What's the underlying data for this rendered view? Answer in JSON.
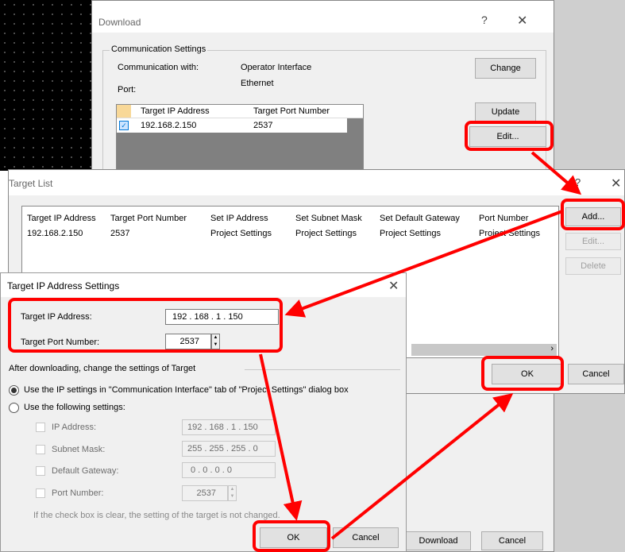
{
  "download": {
    "title": "Download",
    "help": "?",
    "close": "✕",
    "group_title": "Communication Settings",
    "comm_with_label": "Communication with:",
    "comm_with_value": "Operator Interface",
    "port_label": "Port:",
    "port_value": "Ethernet",
    "table_headers": [
      "Target IP Address",
      "Target Port Number"
    ],
    "table_rows": [
      {
        "ip": "192.168.2.150",
        "port": "2537",
        "checked": true
      }
    ],
    "change_label": "Change",
    "update_label": "Update",
    "edit_label": "Edit...",
    "download_label": "Download",
    "cancel_label": "Cancel"
  },
  "target_list": {
    "title": "Target List",
    "help": "?",
    "close": "✕",
    "headers": [
      "Target IP Address",
      "Target Port Number",
      "Set IP Address",
      "Set Subnet Mask",
      "Set Default Gateway",
      "Port Number"
    ],
    "rows": [
      [
        "192.168.2.150",
        "2537",
        "Project Settings",
        "Project Settings",
        "Project Settings",
        "Project Settings"
      ]
    ],
    "add_label": "Add...",
    "edit_label": "Edit...",
    "delete_label": "Delete",
    "ok_label": "OK",
    "cancel_label": "Cancel"
  },
  "ip_settings": {
    "title": "Target IP Address Settings",
    "close": "✕",
    "target_ip_label": "Target IP Address:",
    "target_ip_value": "192 . 168 .  1  . 150",
    "target_port_label": "Target Port Number:",
    "target_port_value": "2537",
    "after_label": "After downloading, change the settings of Target",
    "radio1_label": "Use the IP settings in \"Communication Interface\" tab of \"Project Settings\" dialog box",
    "radio2_label": "Use the following settings:",
    "ip_label": "IP Address:",
    "ip_value": "192 . 168 .  1  . 150",
    "subnet_label": "Subnet Mask:",
    "subnet_value": "255 . 255 . 255 .  0",
    "gateway_label": "Default Gateway:",
    "gateway_value": "0  .  0  .  0  .  0",
    "port_label": "Port Number:",
    "port_value": "2537",
    "note": "If the check box is clear, the setting of the target is not changed.",
    "ok_label": "OK",
    "cancel_label": "Cancel"
  },
  "colors": {
    "highlight": "#ff0000",
    "accent": "#0078d7"
  }
}
